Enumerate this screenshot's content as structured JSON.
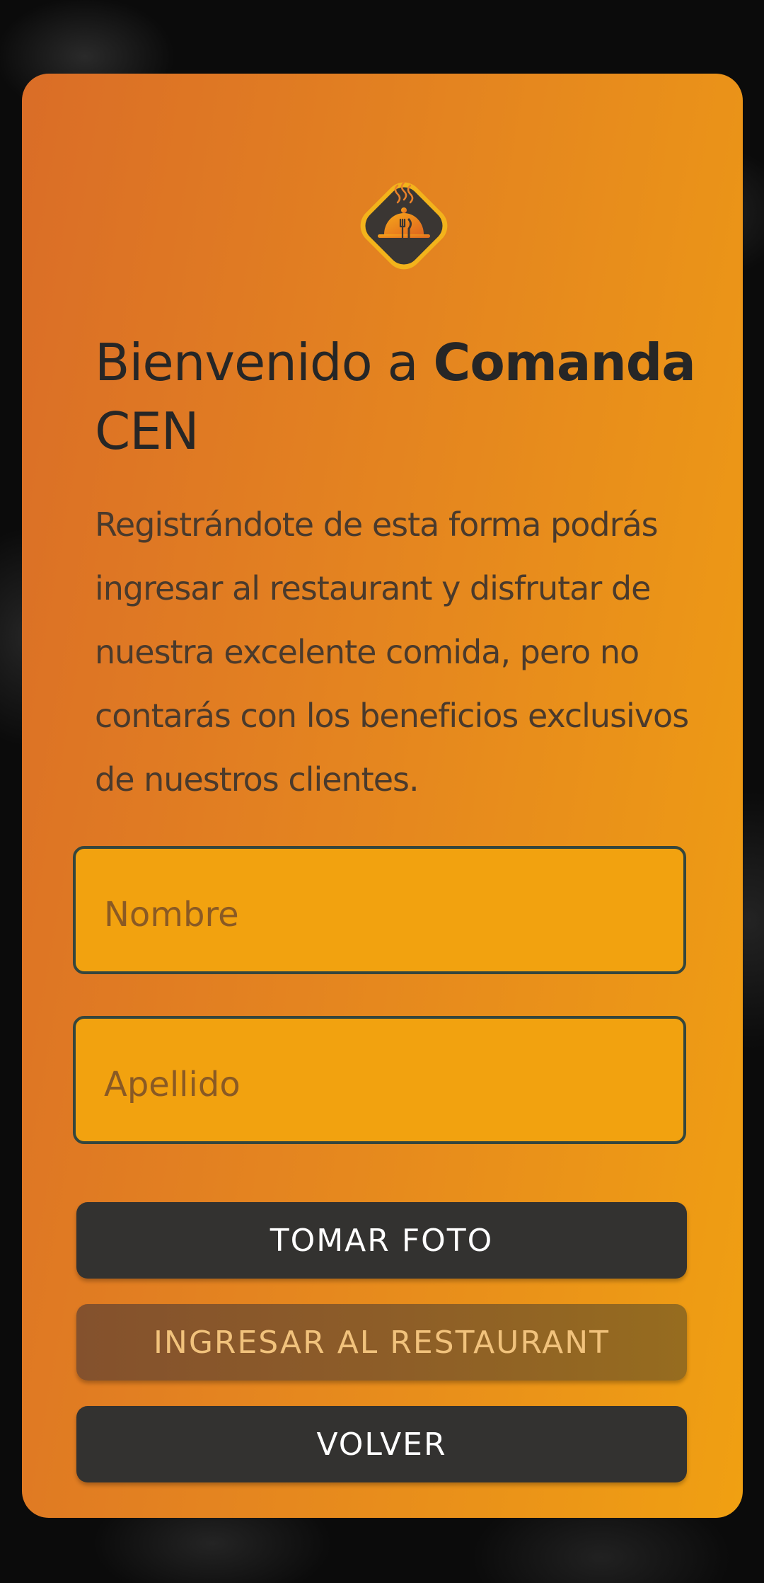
{
  "screen": {
    "title_regular": "Bienvenido a ",
    "title_bold": "Comanda",
    "title_line2": "CEN",
    "description": "Registrándote de esta forma podrás ingresar al restaurant y disfrutar de nuestra excelente comida, pero no contarás con los beneficios exclusivos de nuestros clientes."
  },
  "form": {
    "nombre": {
      "value": "",
      "placeholder": "Nombre"
    },
    "apellido": {
      "value": "",
      "placeholder": "Apellido"
    }
  },
  "buttons": {
    "take_photo": "TOMAR FOTO",
    "enter_restaurant": "INGRESAR AL RESTAURANT",
    "back": "VOLVER"
  },
  "logo": {
    "icon": "serving-cloche-icon"
  },
  "colors": {
    "card_gradient_start": "#da6d27",
    "card_gradient_end": "#f0a012",
    "dark_button": "#333230",
    "input_border": "#35463d",
    "text_dark": "#262626"
  }
}
